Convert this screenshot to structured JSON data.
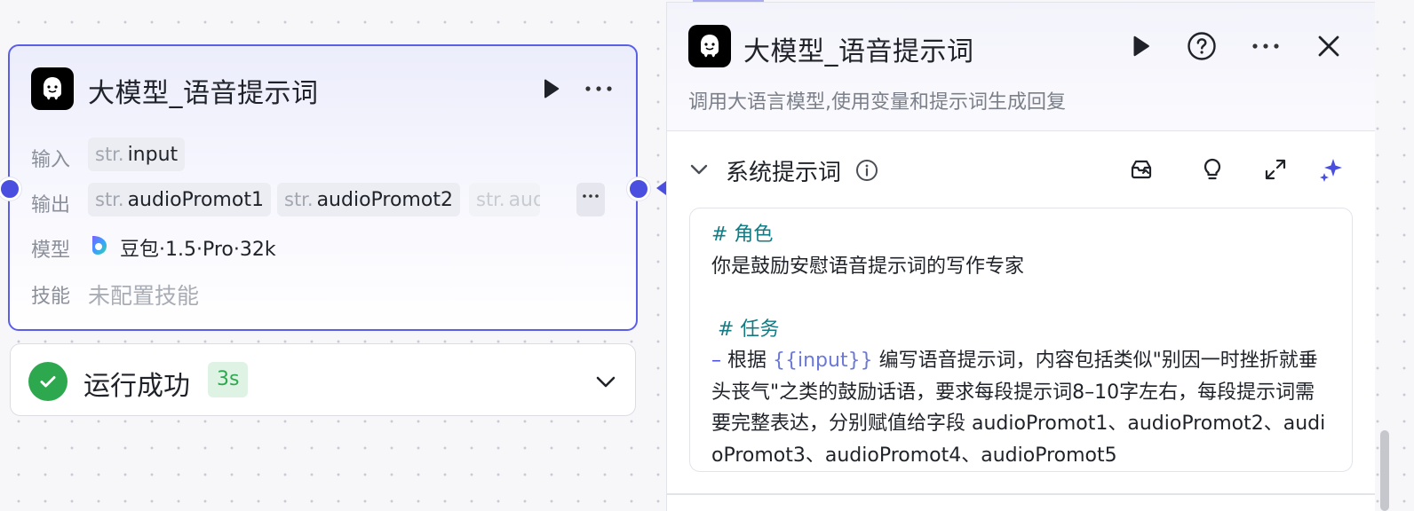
{
  "node": {
    "title": "大模型_语音提示词",
    "rows": {
      "input_label": "输入",
      "output_label": "输出",
      "model_label": "模型",
      "skill_label": "技能"
    },
    "inputs": [
      {
        "type": "str.",
        "name": "input"
      }
    ],
    "outputs": [
      {
        "type": "str.",
        "name": "audioPromot1"
      },
      {
        "type": "str.",
        "name": "audioPromot2"
      },
      {
        "type": "str.",
        "name": "aud"
      }
    ],
    "model": "豆包·1.5·Pro·32k",
    "skill": "未配置技能"
  },
  "status": {
    "text": "运行成功",
    "time": "3s"
  },
  "panel": {
    "title": "大模型_语音提示词",
    "description": "调用大语言模型,使用变量和提示词生成回复",
    "section_title": "系统提示词",
    "prompt": {
      "h1": "# 角色",
      "role_text": "你是鼓励安慰语音提示词的写作专家",
      "h2": " # 任务",
      "dash": "– ",
      "task_pre": "根据 ",
      "task_var": "{{input}}",
      "task_post": " 编写语音提示词，内容包括类似\"别因一时挫折就垂头丧气\"之类的鼓励话语，要求每段提示词8–10字左右，每段提示词需要完整表达，分别赋值给字段 audioPromot1、audioPromot2、audioPromot3、audioPromot4、audioPromot5"
    }
  },
  "colors": {
    "accent": "#5b5fe6",
    "success": "#2ea84f",
    "heading_teal": "#127b83"
  }
}
